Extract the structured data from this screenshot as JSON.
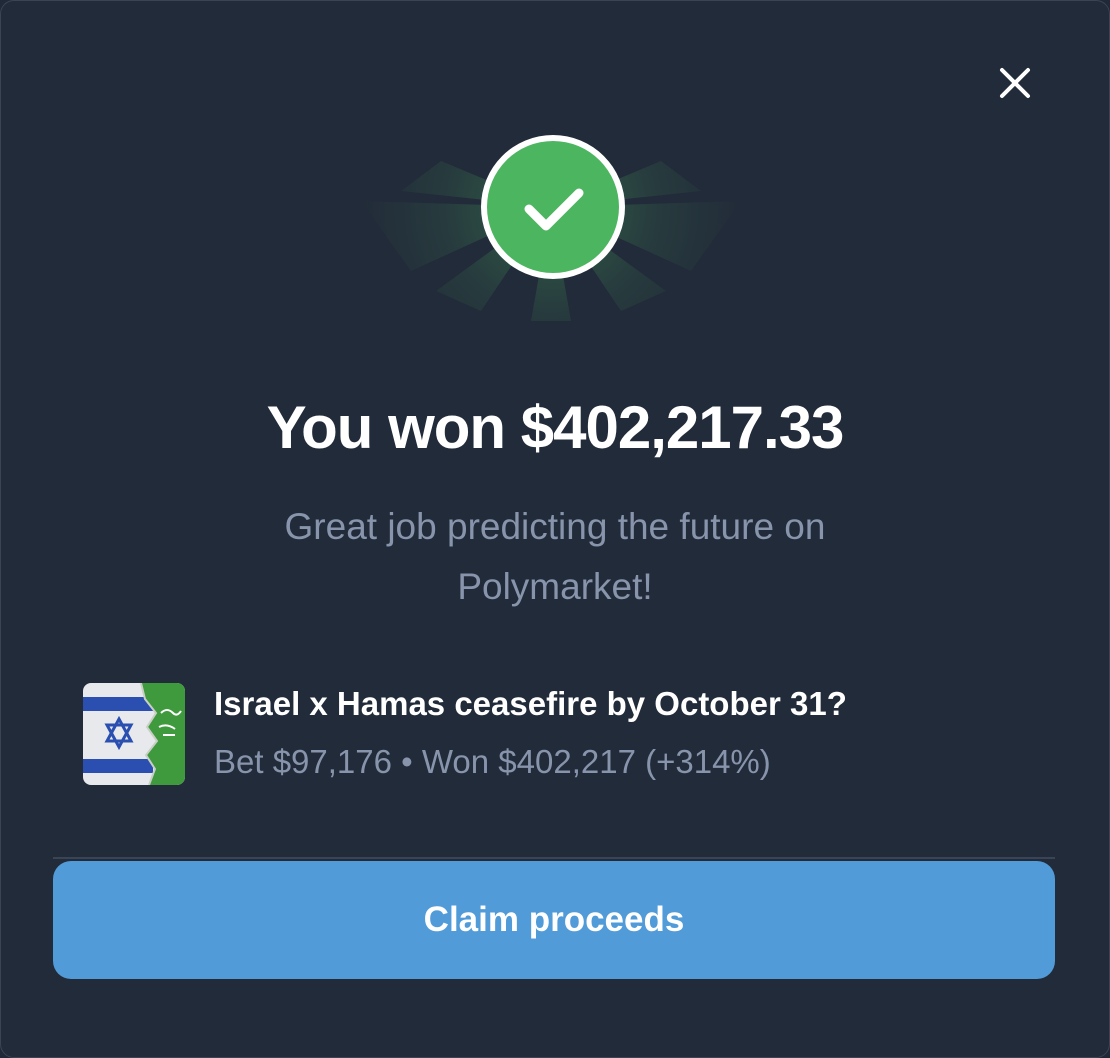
{
  "header": {
    "close_icon": "close-icon"
  },
  "hero": {
    "icon": "checkmark-icon",
    "accent_color": "#4cb560"
  },
  "result": {
    "title": "You won $402,217.33",
    "subtitle": "Great job predicting the future on Polymarket!"
  },
  "market": {
    "thumbnail_icon": "israel-hamas-flags-icon",
    "title": "Israel x Hamas ceasefire by October 31?",
    "stats": "Bet $97,176 • Won $402,217 (+314%)"
  },
  "actions": {
    "claim_label": "Claim proceeds",
    "claim_color": "#509bd8"
  }
}
